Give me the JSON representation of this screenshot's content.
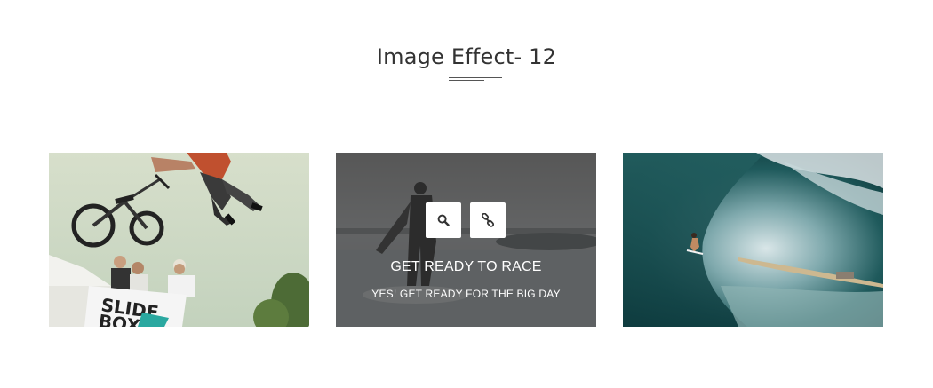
{
  "section": {
    "title": "Image Effect- 12"
  },
  "cards": [
    {
      "photo": "bmx-rider-jump",
      "sign_text": "SLIDE BOX"
    },
    {
      "photo": "surfer-on-beach",
      "title": "GET READY TO RACE",
      "subtitle": "YES! GET READY FOR THE BIG DAY",
      "buttons": [
        {
          "icon": "search-icon"
        },
        {
          "icon": "link-icon"
        }
      ]
    },
    {
      "photo": "wave-barrel-surfer"
    }
  ],
  "colors": {
    "title": "#333333",
    "overlay": "rgba(45,45,45,0.55)",
    "button_bg": "#ffffff"
  }
}
